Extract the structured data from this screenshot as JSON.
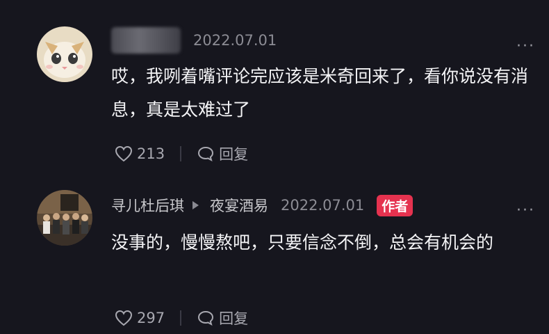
{
  "comments": [
    {
      "username_hidden": true,
      "date": "2022.07.01",
      "text": "哎，我咧着嘴评论完应该是米奇回来了，看你说没有消息，真是太难过了",
      "likes": "213",
      "reply_label": "回复"
    },
    {
      "username": "寻儿杜后琪",
      "reply_to": "夜宴酒易",
      "date": "2022.07.01",
      "badge": "作者",
      "text": "没事的，慢慢熬吧，只要信念不倒，总会有机会的",
      "likes": "297",
      "reply_label": "回复"
    }
  ],
  "icons": {
    "like": "heart-icon",
    "reply": "chat-bubble-icon",
    "more": "more-dots-icon"
  },
  "colors": {
    "background": "#16161e",
    "author_badge": "#e5324f"
  }
}
